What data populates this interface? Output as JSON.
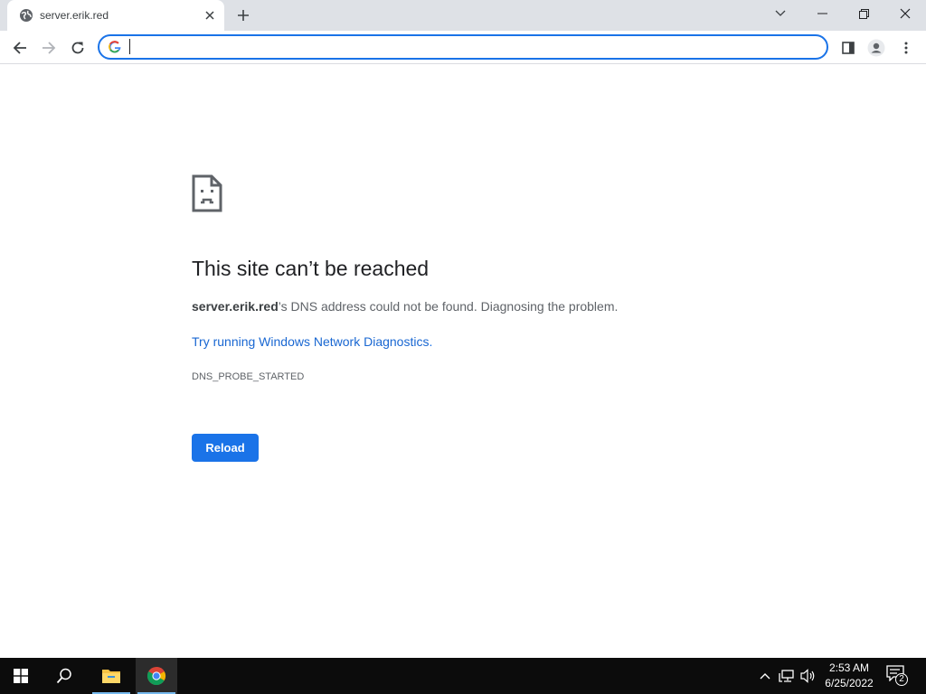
{
  "tab": {
    "title": "server.erik.red",
    "favicon": "globe-icon"
  },
  "toolbar": {
    "omnibox_value": ""
  },
  "error": {
    "icon": "sad-page-icon",
    "title": "This site can’t be reached",
    "host": "server.erik.red",
    "message_rest": "’s DNS address could not be found. Diagnosing the problem.",
    "link_text": "Try running Windows Network Diagnostics",
    "link_suffix": ".",
    "code": "DNS_PROBE_STARTED",
    "reload_label": "Reload"
  },
  "taskbar": {
    "time": "2:53 AM",
    "date": "6/25/2022",
    "notification_count": "2"
  },
  "colors": {
    "accent": "#1a73e8",
    "tabstrip": "#dee1e6",
    "taskbar": "#0c0c0c"
  }
}
